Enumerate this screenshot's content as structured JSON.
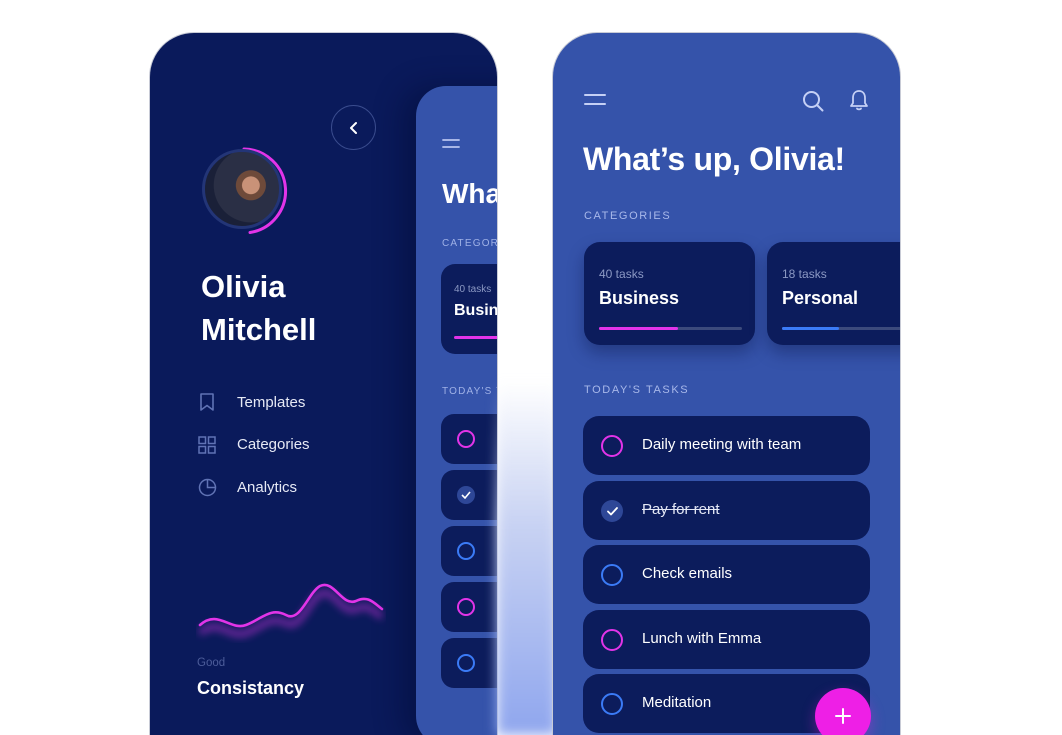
{
  "colors": {
    "drawer_bg": "#0a1a5b",
    "screen_bg": "#3553aa",
    "card_bg": "#0c1c5c",
    "accent_pink": "#e234e8",
    "accent_blue": "#3b7bf6",
    "fab": "#ee1fe6"
  },
  "drawer": {
    "back_icon": "chevron-left-icon",
    "profile": {
      "name_line1": "Olivia",
      "name_line2": "Mitchell",
      "avatar": "user-photo"
    },
    "menu": [
      {
        "label": "Templates",
        "icon": "bookmark-icon"
      },
      {
        "label": "Categories",
        "icon": "grid-icon"
      },
      {
        "label": "Analytics",
        "icon": "pie-chart-icon"
      }
    ],
    "consistency": {
      "sub": "Good",
      "title": "Consistancy"
    }
  },
  "mini_screen": {
    "title": "What",
    "categories_label": "CATEGOR",
    "card": {
      "count": "40 tasks",
      "name": "Busin"
    },
    "today_label": "TODAY'S TA"
  },
  "main": {
    "greeting": "What’s up, Olivia!",
    "categories_label": "CATEGORIES",
    "categories": [
      {
        "count": "40 tasks",
        "name": "Business",
        "progress": 0.55,
        "color": "#e234e8"
      },
      {
        "count": "18 tasks",
        "name": "Personal",
        "progress": 0.4,
        "color": "#3b7bf6"
      }
    ],
    "today_label": "TODAY'S TASKS",
    "tasks": [
      {
        "label": "Daily meeting with team",
        "done": false,
        "color": "#e234e8"
      },
      {
        "label": "Pay for rent",
        "done": true,
        "color": "#3b7bf6"
      },
      {
        "label": "Check emails",
        "done": false,
        "color": "#3b7bf6"
      },
      {
        "label": "Lunch with Emma",
        "done": false,
        "color": "#e234e8"
      },
      {
        "label": "Meditation",
        "done": false,
        "color": "#3b7bf6"
      }
    ],
    "fab_icon": "plus-icon"
  }
}
